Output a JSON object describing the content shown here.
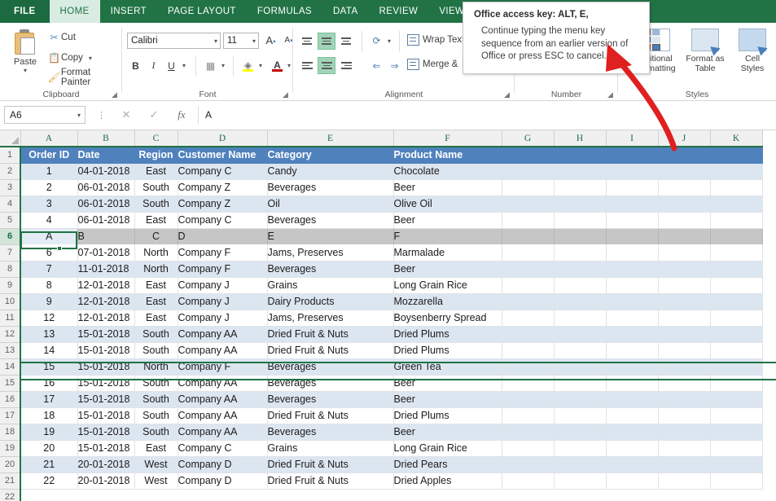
{
  "ribbon": {
    "tabs": [
      {
        "label": "FILE",
        "state": "file"
      },
      {
        "label": "HOME",
        "state": "active"
      },
      {
        "label": "INSERT",
        "state": "normal"
      },
      {
        "label": "PAGE LAYOUT",
        "state": "normal"
      },
      {
        "label": "FORMULAS",
        "state": "normal"
      },
      {
        "label": "DATA",
        "state": "normal"
      },
      {
        "label": "REVIEW",
        "state": "normal"
      },
      {
        "label": "VIEW",
        "state": "normal"
      }
    ],
    "clipboard": {
      "group_label": "Clipboard",
      "paste_label": "Paste",
      "cut_label": "Cut",
      "copy_label": "Copy",
      "format_painter_label": "Format Painter",
      "cut_icon": "scissors-icon",
      "copy_icon": "copy-icon",
      "format_painter_icon": "paintbrush-icon"
    },
    "font": {
      "group_label": "Font",
      "font_family_value": "Calibri",
      "font_size_value": "11",
      "grow_font_label": "A",
      "shrink_font_label": "A",
      "bold_label": "B",
      "italic_label": "I",
      "underline_label": "U",
      "borders_icon": "borders-icon",
      "fill_color_label": "A",
      "font_color_label": "A",
      "fill_color_hex": "#ffff00",
      "font_color_hex": "#c00000"
    },
    "alignment": {
      "group_label": "Alignment",
      "wrap_text_label": "Wrap Text",
      "merge_label": "Merge &",
      "orientation_icon": "orientation-icon",
      "decrease_indent_icon": "decrease-indent-icon",
      "increase_indent_icon": "increase-indent-icon"
    },
    "number": {
      "group_label": "Number"
    },
    "styles": {
      "group_label": "Styles",
      "items": [
        {
          "line1": "nditional",
          "line2": "rormatting"
        },
        {
          "line1": "Format as",
          "line2": "Table"
        },
        {
          "line1": "Cell",
          "line2": "Styles"
        }
      ]
    }
  },
  "formula_bar": {
    "name_box_value": "A6",
    "cancel_icon": "cancel-x-icon",
    "confirm_icon": "confirm-check-icon",
    "function_icon": "fx-icon",
    "formula_value": "A",
    "dots_icon": "vertical-dots-icon"
  },
  "tooltip": {
    "title": "Office access key: ALT, E,",
    "body": "Continue typing the menu key sequence from an earlier version of Office or press ESC to cancel.",
    "arrow_color": "#e02020"
  },
  "sheet": {
    "columns": [
      "A",
      "B",
      "C",
      "D",
      "E",
      "F",
      "G",
      "H",
      "I",
      "J",
      "K"
    ],
    "selected_cell": "A6",
    "selected_row": 6,
    "rows": [
      {
        "n": 1,
        "style": "header",
        "cells": [
          "Order ID",
          "Date",
          "Region",
          "Customer Name",
          "Category",
          "Product Name",
          "",
          "",
          "",
          "",
          ""
        ]
      },
      {
        "n": 2,
        "style": "band",
        "cells": [
          "1",
          "04-01-2018",
          "East",
          "Company C",
          "Candy",
          "Chocolate",
          "",
          "",
          "",
          "",
          ""
        ]
      },
      {
        "n": 3,
        "style": "plain",
        "cells": [
          "2",
          "06-01-2018",
          "South",
          "Company Z",
          "Beverages",
          "Beer",
          "",
          "",
          "",
          "",
          ""
        ]
      },
      {
        "n": 4,
        "style": "band",
        "cells": [
          "3",
          "06-01-2018",
          "South",
          "Company Z",
          "Oil",
          "Olive Oil",
          "",
          "",
          "",
          "",
          ""
        ]
      },
      {
        "n": 5,
        "style": "plain",
        "cells": [
          "4",
          "06-01-2018",
          "East",
          "Company C",
          "Beverages",
          "Beer",
          "",
          "",
          "",
          "",
          ""
        ]
      },
      {
        "n": 6,
        "style": "selected",
        "cells": [
          "A",
          "B",
          "C",
          "D",
          "E",
          "F",
          "",
          "",
          "",
          "",
          ""
        ]
      },
      {
        "n": 7,
        "style": "plain",
        "cells": [
          "6",
          "07-01-2018",
          "North",
          "Company F",
          "Jams, Preserves",
          "Marmalade",
          "",
          "",
          "",
          "",
          ""
        ]
      },
      {
        "n": 8,
        "style": "band",
        "cells": [
          "7",
          "11-01-2018",
          "North",
          "Company F",
          "Beverages",
          "Beer",
          "",
          "",
          "",
          "",
          ""
        ]
      },
      {
        "n": 9,
        "style": "plain",
        "cells": [
          "8",
          "12-01-2018",
          "East",
          "Company J",
          "Grains",
          "Long Grain Rice",
          "",
          "",
          "",
          "",
          ""
        ]
      },
      {
        "n": 10,
        "style": "band",
        "cells": [
          "9",
          "12-01-2018",
          "East",
          "Company J",
          "Dairy Products",
          "Mozzarella",
          "",
          "",
          "",
          "",
          ""
        ]
      },
      {
        "n": 11,
        "style": "plain",
        "cells": [
          "12",
          "12-01-2018",
          "East",
          "Company J",
          "Jams, Preserves",
          "Boysenberry Spread",
          "",
          "",
          "",
          "",
          ""
        ]
      },
      {
        "n": 12,
        "style": "band",
        "cells": [
          "13",
          "15-01-2018",
          "South",
          "Company AA",
          "Dried Fruit & Nuts",
          "Dried Plums",
          "",
          "",
          "",
          "",
          ""
        ]
      },
      {
        "n": 13,
        "style": "plain",
        "cells": [
          "14",
          "15-01-2018",
          "South",
          "Company AA",
          "Dried Fruit & Nuts",
          "Dried Plums",
          "",
          "",
          "",
          "",
          ""
        ]
      },
      {
        "n": 14,
        "style": "band",
        "cells": [
          "15",
          "15-01-2018",
          "North",
          "Company F",
          "Beverages",
          "Green Tea",
          "",
          "",
          "",
          "",
          ""
        ]
      },
      {
        "n": 15,
        "style": "plain",
        "cells": [
          "16",
          "15-01-2018",
          "South",
          "Company AA",
          "Beverages",
          "Beer",
          "",
          "",
          "",
          "",
          ""
        ]
      },
      {
        "n": 16,
        "style": "band",
        "cells": [
          "17",
          "15-01-2018",
          "South",
          "Company AA",
          "Beverages",
          "Beer",
          "",
          "",
          "",
          "",
          ""
        ]
      },
      {
        "n": 17,
        "style": "plain",
        "cells": [
          "18",
          "15-01-2018",
          "South",
          "Company AA",
          "Dried Fruit & Nuts",
          "Dried Plums",
          "",
          "",
          "",
          "",
          ""
        ]
      },
      {
        "n": 18,
        "style": "band",
        "cells": [
          "19",
          "15-01-2018",
          "South",
          "Company AA",
          "Beverages",
          "Beer",
          "",
          "",
          "",
          "",
          ""
        ]
      },
      {
        "n": 19,
        "style": "plain",
        "cells": [
          "20",
          "15-01-2018",
          "East",
          "Company C",
          "Grains",
          "Long Grain Rice",
          "",
          "",
          "",
          "",
          ""
        ]
      },
      {
        "n": 20,
        "style": "band",
        "cells": [
          "21",
          "20-01-2018",
          "West",
          "Company D",
          "Dried Fruit & Nuts",
          "Dried Pears",
          "",
          "",
          "",
          "",
          ""
        ]
      },
      {
        "n": 21,
        "style": "plain",
        "cells": [
          "22",
          "20-01-2018",
          "West",
          "Company D",
          "Dried Fruit & Nuts",
          "Dried Apples",
          "",
          "",
          "",
          "",
          ""
        ]
      },
      {
        "n": 22,
        "style": "blank",
        "cells": [
          "",
          "",
          "",
          "",
          "",
          "",
          "",
          "",
          "",
          "",
          ""
        ]
      }
    ]
  }
}
